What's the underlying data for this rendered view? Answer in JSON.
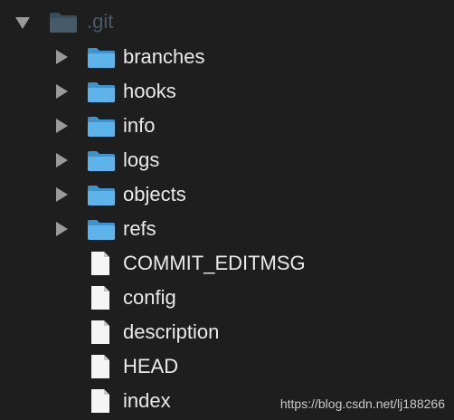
{
  "root": {
    "label": ".git",
    "icon": "folder-icon"
  },
  "folders": [
    {
      "label": "branches"
    },
    {
      "label": "hooks"
    },
    {
      "label": "info"
    },
    {
      "label": "logs"
    },
    {
      "label": "objects"
    },
    {
      "label": "refs"
    }
  ],
  "files": [
    {
      "label": "COMMIT_EDITMSG"
    },
    {
      "label": "config"
    },
    {
      "label": "description"
    },
    {
      "label": "HEAD"
    },
    {
      "label": "index"
    }
  ],
  "watermark": "https://blog.csdn.net/lj188266",
  "colors": {
    "background": "#1e1e1e",
    "folder": "#5aaee3",
    "root_folder": "#415563",
    "text": "#eaeaea",
    "disclosure": "#9a9a9a"
  }
}
